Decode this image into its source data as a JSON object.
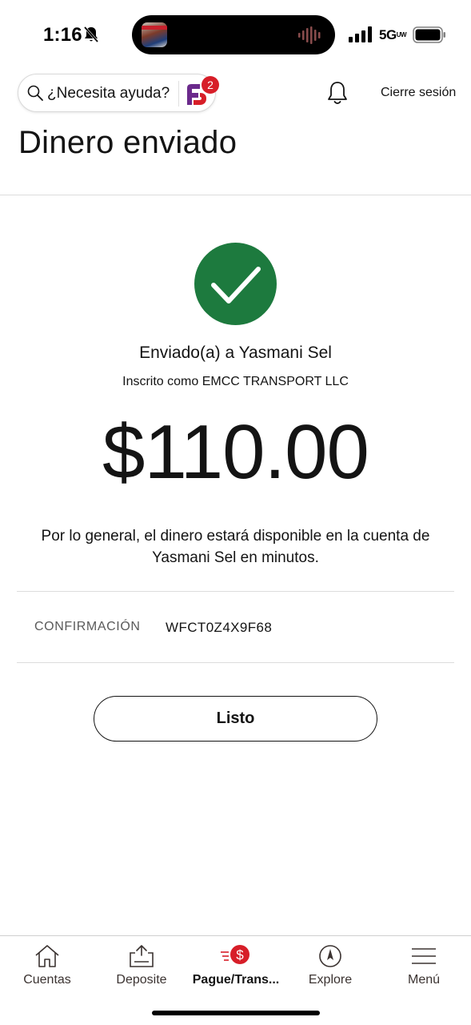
{
  "status_bar": {
    "time": "1:16",
    "network": "5G",
    "network_sup": "UW"
  },
  "header": {
    "help_placeholder": "¿Necesita ayuda?",
    "fargo_badge_count": "2",
    "logout_label": "Cierre sesión"
  },
  "page_title": "Dinero enviado",
  "confirmation": {
    "sent_to": "Enviado(a) a Yasmani Sel",
    "enrolled_as": "Inscrito como EMCC TRANSPORT LLC",
    "amount": "$110.00",
    "availability_line1": "Por lo general, el dinero estará disponible en la cuenta de",
    "availability_line2": "Yasmani Sel en minutos.",
    "confirmation_label": "CONFIRMACIÓN",
    "confirmation_number": "WFCT0Z4X9F68",
    "done_label": "Listo"
  },
  "colors": {
    "success_green": "#1d7a3e",
    "brand_red": "#d71e28",
    "fargo_purple": "#6b2a8c"
  },
  "bottom_nav": {
    "items": [
      {
        "label": "Cuentas",
        "icon": "home-icon",
        "active": false
      },
      {
        "label": "Deposite",
        "icon": "deposit-icon",
        "active": false
      },
      {
        "label": "Pague/Trans...",
        "icon": "pay-transfer-icon",
        "active": true
      },
      {
        "label": "Explore",
        "icon": "compass-icon",
        "active": false
      },
      {
        "label": "Menú",
        "icon": "hamburger-menu-icon",
        "active": false
      }
    ]
  }
}
